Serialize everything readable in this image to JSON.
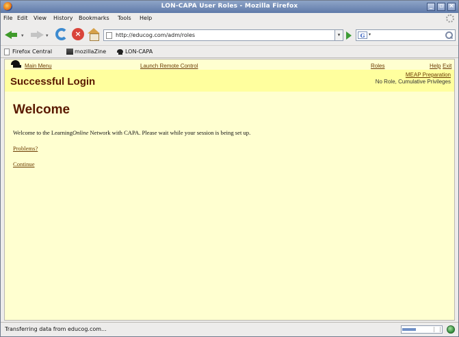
{
  "window": {
    "title": "LON-CAPA User Roles - Mozilla Firefox",
    "controls": [
      "minimize-icon",
      "maximize-icon",
      "close-icon"
    ]
  },
  "menubar": {
    "items": [
      "File",
      "Edit",
      "View",
      "History",
      "Bookmarks",
      "Tools",
      "Help"
    ]
  },
  "navbar": {
    "url": "http://educog.com/adm/roles",
    "search_engine_letter": "G",
    "search_value": ""
  },
  "bookmarks": {
    "items": [
      "Firefox Central",
      "mozillaZine",
      "LON-CAPA"
    ]
  },
  "page": {
    "top_links": {
      "main_menu": "Main Menu",
      "launch_remote": "Launch Remote Control",
      "roles": "Roles",
      "help": "Help",
      "exit": "Exit"
    },
    "header": {
      "title": "Successful Login",
      "course": "MEAP Preparation",
      "privileges": "No Role, Cumulative Privileges"
    },
    "welcome_heading": "Welcome",
    "intro_before": "Welcome to the Learning",
    "intro_italic": "Online",
    "intro_after": " Network with CAPA. Please wait while your session is being set up.",
    "problems_link": "Problems?",
    "continue_link": "Continue"
  },
  "statusbar": {
    "text": "Transferring data from educog.com...",
    "progress_fraction": 0.35
  },
  "colors": {
    "page_background": "#ffffd0",
    "header_background": "#ffff9e",
    "heading_brown": "#5a1a00",
    "link_brown": "#6b3a00"
  }
}
